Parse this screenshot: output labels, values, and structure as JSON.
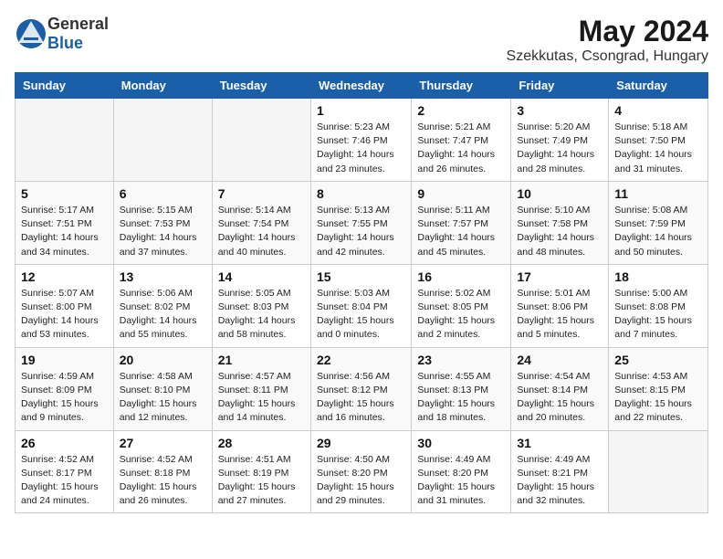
{
  "header": {
    "logo_general": "General",
    "logo_blue": "Blue",
    "month_year": "May 2024",
    "location": "Szekkutas, Csongrad, Hungary"
  },
  "days_of_week": [
    "Sunday",
    "Monday",
    "Tuesday",
    "Wednesday",
    "Thursday",
    "Friday",
    "Saturday"
  ],
  "weeks": [
    [
      {
        "day": "",
        "sunrise": "",
        "sunset": "",
        "daylight": ""
      },
      {
        "day": "",
        "sunrise": "",
        "sunset": "",
        "daylight": ""
      },
      {
        "day": "",
        "sunrise": "",
        "sunset": "",
        "daylight": ""
      },
      {
        "day": "1",
        "sunrise": "Sunrise: 5:23 AM",
        "sunset": "Sunset: 7:46 PM",
        "daylight": "Daylight: 14 hours and 23 minutes."
      },
      {
        "day": "2",
        "sunrise": "Sunrise: 5:21 AM",
        "sunset": "Sunset: 7:47 PM",
        "daylight": "Daylight: 14 hours and 26 minutes."
      },
      {
        "day": "3",
        "sunrise": "Sunrise: 5:20 AM",
        "sunset": "Sunset: 7:49 PM",
        "daylight": "Daylight: 14 hours and 28 minutes."
      },
      {
        "day": "4",
        "sunrise": "Sunrise: 5:18 AM",
        "sunset": "Sunset: 7:50 PM",
        "daylight": "Daylight: 14 hours and 31 minutes."
      }
    ],
    [
      {
        "day": "5",
        "sunrise": "Sunrise: 5:17 AM",
        "sunset": "Sunset: 7:51 PM",
        "daylight": "Daylight: 14 hours and 34 minutes."
      },
      {
        "day": "6",
        "sunrise": "Sunrise: 5:15 AM",
        "sunset": "Sunset: 7:53 PM",
        "daylight": "Daylight: 14 hours and 37 minutes."
      },
      {
        "day": "7",
        "sunrise": "Sunrise: 5:14 AM",
        "sunset": "Sunset: 7:54 PM",
        "daylight": "Daylight: 14 hours and 40 minutes."
      },
      {
        "day": "8",
        "sunrise": "Sunrise: 5:13 AM",
        "sunset": "Sunset: 7:55 PM",
        "daylight": "Daylight: 14 hours and 42 minutes."
      },
      {
        "day": "9",
        "sunrise": "Sunrise: 5:11 AM",
        "sunset": "Sunset: 7:57 PM",
        "daylight": "Daylight: 14 hours and 45 minutes."
      },
      {
        "day": "10",
        "sunrise": "Sunrise: 5:10 AM",
        "sunset": "Sunset: 7:58 PM",
        "daylight": "Daylight: 14 hours and 48 minutes."
      },
      {
        "day": "11",
        "sunrise": "Sunrise: 5:08 AM",
        "sunset": "Sunset: 7:59 PM",
        "daylight": "Daylight: 14 hours and 50 minutes."
      }
    ],
    [
      {
        "day": "12",
        "sunrise": "Sunrise: 5:07 AM",
        "sunset": "Sunset: 8:00 PM",
        "daylight": "Daylight: 14 hours and 53 minutes."
      },
      {
        "day": "13",
        "sunrise": "Sunrise: 5:06 AM",
        "sunset": "Sunset: 8:02 PM",
        "daylight": "Daylight: 14 hours and 55 minutes."
      },
      {
        "day": "14",
        "sunrise": "Sunrise: 5:05 AM",
        "sunset": "Sunset: 8:03 PM",
        "daylight": "Daylight: 14 hours and 58 minutes."
      },
      {
        "day": "15",
        "sunrise": "Sunrise: 5:03 AM",
        "sunset": "Sunset: 8:04 PM",
        "daylight": "Daylight: 15 hours and 0 minutes."
      },
      {
        "day": "16",
        "sunrise": "Sunrise: 5:02 AM",
        "sunset": "Sunset: 8:05 PM",
        "daylight": "Daylight: 15 hours and 2 minutes."
      },
      {
        "day": "17",
        "sunrise": "Sunrise: 5:01 AM",
        "sunset": "Sunset: 8:06 PM",
        "daylight": "Daylight: 15 hours and 5 minutes."
      },
      {
        "day": "18",
        "sunrise": "Sunrise: 5:00 AM",
        "sunset": "Sunset: 8:08 PM",
        "daylight": "Daylight: 15 hours and 7 minutes."
      }
    ],
    [
      {
        "day": "19",
        "sunrise": "Sunrise: 4:59 AM",
        "sunset": "Sunset: 8:09 PM",
        "daylight": "Daylight: 15 hours and 9 minutes."
      },
      {
        "day": "20",
        "sunrise": "Sunrise: 4:58 AM",
        "sunset": "Sunset: 8:10 PM",
        "daylight": "Daylight: 15 hours and 12 minutes."
      },
      {
        "day": "21",
        "sunrise": "Sunrise: 4:57 AM",
        "sunset": "Sunset: 8:11 PM",
        "daylight": "Daylight: 15 hours and 14 minutes."
      },
      {
        "day": "22",
        "sunrise": "Sunrise: 4:56 AM",
        "sunset": "Sunset: 8:12 PM",
        "daylight": "Daylight: 15 hours and 16 minutes."
      },
      {
        "day": "23",
        "sunrise": "Sunrise: 4:55 AM",
        "sunset": "Sunset: 8:13 PM",
        "daylight": "Daylight: 15 hours and 18 minutes."
      },
      {
        "day": "24",
        "sunrise": "Sunrise: 4:54 AM",
        "sunset": "Sunset: 8:14 PM",
        "daylight": "Daylight: 15 hours and 20 minutes."
      },
      {
        "day": "25",
        "sunrise": "Sunrise: 4:53 AM",
        "sunset": "Sunset: 8:15 PM",
        "daylight": "Daylight: 15 hours and 22 minutes."
      }
    ],
    [
      {
        "day": "26",
        "sunrise": "Sunrise: 4:52 AM",
        "sunset": "Sunset: 8:17 PM",
        "daylight": "Daylight: 15 hours and 24 minutes."
      },
      {
        "day": "27",
        "sunrise": "Sunrise: 4:52 AM",
        "sunset": "Sunset: 8:18 PM",
        "daylight": "Daylight: 15 hours and 26 minutes."
      },
      {
        "day": "28",
        "sunrise": "Sunrise: 4:51 AM",
        "sunset": "Sunset: 8:19 PM",
        "daylight": "Daylight: 15 hours and 27 minutes."
      },
      {
        "day": "29",
        "sunrise": "Sunrise: 4:50 AM",
        "sunset": "Sunset: 8:20 PM",
        "daylight": "Daylight: 15 hours and 29 minutes."
      },
      {
        "day": "30",
        "sunrise": "Sunrise: 4:49 AM",
        "sunset": "Sunset: 8:20 PM",
        "daylight": "Daylight: 15 hours and 31 minutes."
      },
      {
        "day": "31",
        "sunrise": "Sunrise: 4:49 AM",
        "sunset": "Sunset: 8:21 PM",
        "daylight": "Daylight: 15 hours and 32 minutes."
      },
      {
        "day": "",
        "sunrise": "",
        "sunset": "",
        "daylight": ""
      }
    ]
  ]
}
